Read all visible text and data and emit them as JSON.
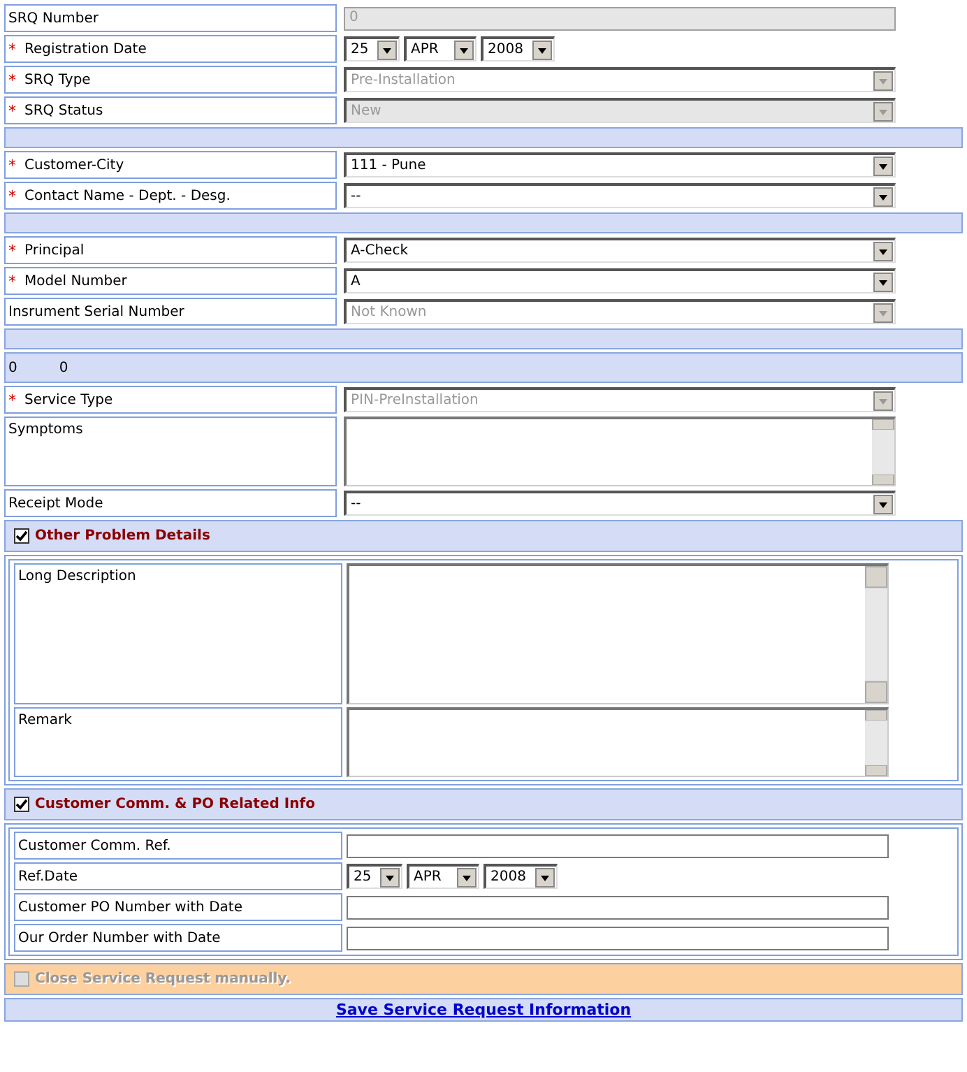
{
  "rows": [
    {
      "kind": "field",
      "label": "SRQ Number",
      "control": {
        "kind": "text",
        "value": "0",
        "disabled": true
      }
    },
    {
      "kind": "field",
      "label": "Registration Date",
      "mark": "*",
      "control": {
        "kind": "date",
        "day": "25",
        "month": "APR",
        "year": "2008"
      }
    },
    {
      "kind": "field",
      "label": "SRQ Type",
      "mark": "*",
      "control": {
        "kind": "select",
        "value": "Pre-Installation",
        "disabled": true,
        "shaded": false
      }
    },
    {
      "kind": "field",
      "label": "SRQ Status",
      "mark": "*",
      "control": {
        "kind": "select",
        "value": "New",
        "disabled": true,
        "shaded": true
      }
    },
    {
      "kind": "spacer"
    },
    {
      "kind": "field",
      "label": "Customer-City",
      "mark": "*",
      "control": {
        "kind": "select",
        "value": "111 - Pune",
        "disabled": false,
        "shaded": false
      }
    },
    {
      "kind": "field",
      "label": "Contact Name - Dept. - Desg.",
      "mark": "*",
      "control": {
        "kind": "select",
        "value": "--",
        "disabled": false,
        "shaded": false
      }
    },
    {
      "kind": "spacer"
    },
    {
      "kind": "field",
      "label": "Principal",
      "mark": "*",
      "control": {
        "kind": "select",
        "value": "A-Check",
        "disabled": false,
        "shaded": false
      }
    },
    {
      "kind": "field",
      "label": "Model Number",
      "mark": "*",
      "control": {
        "kind": "select",
        "value": "A",
        "disabled": false,
        "shaded": false
      }
    },
    {
      "kind": "field",
      "label": "Insrument Serial Number",
      "control": {
        "kind": "select",
        "value": "Not Known",
        "disabled": true,
        "shaded": false
      }
    },
    {
      "kind": "spacer"
    },
    {
      "kind": "info",
      "values": [
        "0",
        "0"
      ]
    },
    {
      "kind": "field",
      "label": "Service Type",
      "mark": "*",
      "control": {
        "kind": "select",
        "value": "PIN-PreInstallation",
        "disabled": true,
        "shaded": false
      }
    },
    {
      "kind": "field",
      "label": "Symptoms",
      "control": {
        "kind": "textarea"
      }
    },
    {
      "kind": "field",
      "label": "Receipt Mode",
      "control": {
        "kind": "select",
        "value": "--",
        "disabled": false,
        "shaded": false
      }
    },
    {
      "kind": "section",
      "title": "Other Problem Details",
      "checked": true,
      "disabled": false,
      "children": [
        {
          "label": "Long Description",
          "control": {
            "kind": "textarea"
          }
        },
        {
          "label": "Remark",
          "control": {
            "kind": "textarea"
          }
        }
      ]
    },
    {
      "kind": "section",
      "title": "Customer Comm. & PO Related Info",
      "checked": true,
      "disabled": false,
      "children": [
        {
          "label": "Customer Comm. Ref.",
          "control": {
            "kind": "text",
            "disabled": false
          }
        },
        {
          "label": "Ref.Date",
          "control": {
            "kind": "date",
            "day": "25",
            "month": "APR",
            "year": "2008"
          }
        },
        {
          "label": "Customer PO Number with Date",
          "control": {
            "kind": "text",
            "disabled": false
          }
        },
        {
          "label": "Our Order Number with Date",
          "control": {
            "kind": "text",
            "disabled": false
          }
        }
      ]
    },
    {
      "kind": "section",
      "title": "Close Service Request manually.",
      "checked": false,
      "disabled": true
    },
    {
      "kind": "action",
      "label": "Save Service Request Information"
    }
  ]
}
